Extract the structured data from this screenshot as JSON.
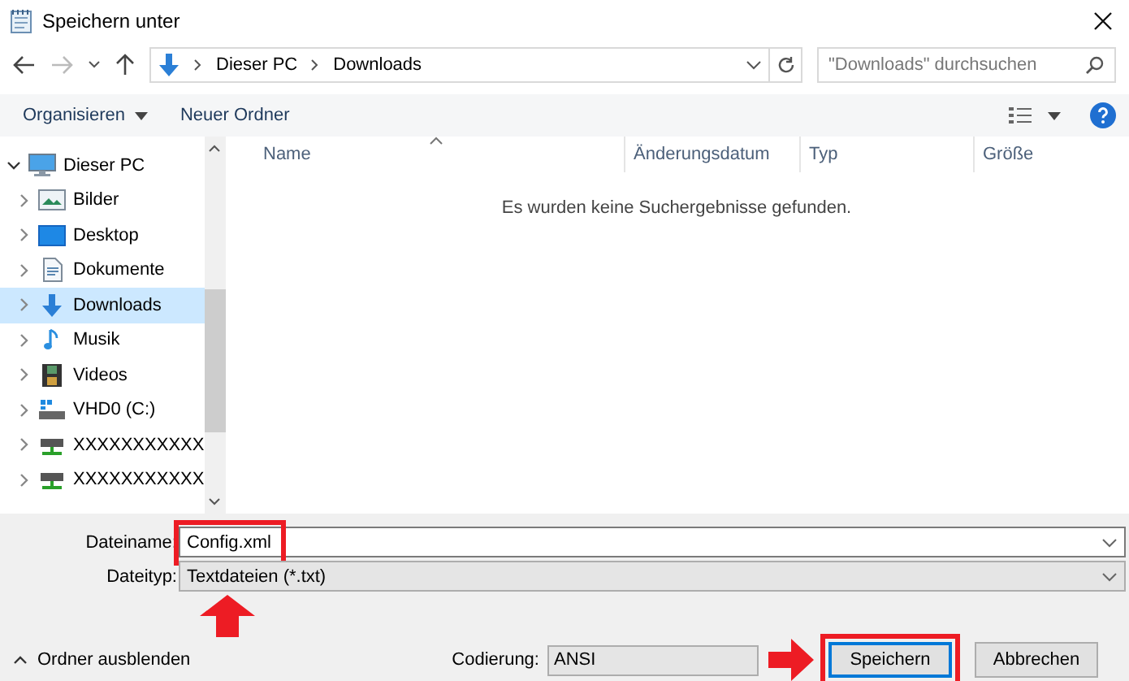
{
  "window": {
    "title": "Speichern unter"
  },
  "address": {
    "path": [
      "Dieser PC",
      "Downloads"
    ],
    "search_placeholder": "\"Downloads\" durchsuchen"
  },
  "toolbar": {
    "organize": "Organisieren",
    "new_folder": "Neuer Ordner"
  },
  "tree": [
    {
      "label": "Dieser PC",
      "kind": "pc",
      "expanded": true,
      "selected": false,
      "children": [
        {
          "label": "Bilder",
          "kind": "pictures",
          "expanded": false,
          "selected": false
        },
        {
          "label": "Desktop",
          "kind": "desktop",
          "expanded": false,
          "selected": false
        },
        {
          "label": "Dokumente",
          "kind": "documents",
          "expanded": false,
          "selected": false
        },
        {
          "label": "Downloads",
          "kind": "downloads",
          "expanded": false,
          "selected": true
        },
        {
          "label": "Musik",
          "kind": "music",
          "expanded": false,
          "selected": false
        },
        {
          "label": "Videos",
          "kind": "videos",
          "expanded": false,
          "selected": false
        },
        {
          "label": "VHD0 (C:)",
          "kind": "drive",
          "expanded": false,
          "selected": false
        },
        {
          "label": "XXXXXXXXXXX",
          "kind": "network",
          "expanded": false,
          "selected": false
        },
        {
          "label": "XXXXXXXXXXX",
          "kind": "network",
          "expanded": false,
          "selected": false
        }
      ]
    }
  ],
  "columns": [
    "Name",
    "Änderungsdatum",
    "Typ",
    "Größe"
  ],
  "empty_message": "Es wurden keine Suchergebnisse gefunden.",
  "filename": {
    "label": "Dateiname:",
    "value": "Config.xml",
    "highlighted": true,
    "marker_arrow": true
  },
  "filetype": {
    "label": "Dateityp:",
    "value": "Textdateien (*.txt)"
  },
  "hide_folders": "Ordner ausblenden",
  "encoding": {
    "label": "Codierung:",
    "value": "ANSI"
  },
  "buttons": [
    {
      "label": "Speichern",
      "kind": "primary",
      "highlighted": true,
      "marker_arrow": true
    },
    {
      "label": "Abbrechen",
      "kind": "normal",
      "highlighted": false
    }
  ]
}
